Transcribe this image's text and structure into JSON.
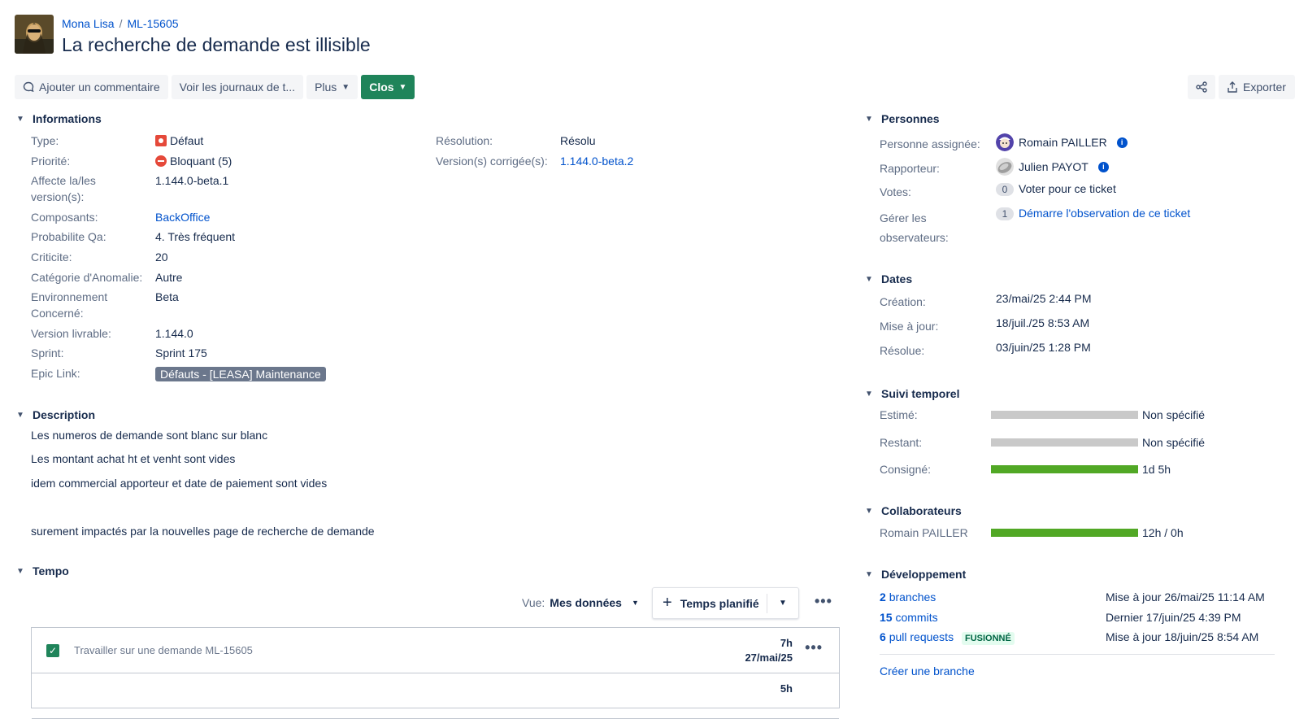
{
  "breadcrumb": {
    "project": "Mona Lisa",
    "issue_key": "ML-15605"
  },
  "title": "La recherche de demande est illisible",
  "toolbar": {
    "comment": "Ajouter un commentaire",
    "logs": "Voir les journaux de t...",
    "more": "Plus",
    "status": "Clos",
    "export": "Exporter"
  },
  "details": {
    "heading": "Informations",
    "type_label": "Type:",
    "type_value": "Défaut",
    "priority_label": "Priorité:",
    "priority_value": "Bloquant (5)",
    "affects_label_1": "Affecte la/les",
    "affects_label_2": "version(s):",
    "affects_value": "1.144.0-beta.1",
    "components_label": "Composants:",
    "components_value": "BackOffice",
    "proba_label": "Probabilite Qa:",
    "proba_value": "4. Très fréquent",
    "crit_label": "Criticite:",
    "crit_value": "20",
    "cat_label": "Catégorie d'Anomalie:",
    "cat_value": "Autre",
    "env_label_1": "Environnement",
    "env_label_2": "Concerné:",
    "env_value": "Beta",
    "deliv_label": "Version livrable:",
    "deliv_value": "1.144.0",
    "sprint_label": "Sprint:",
    "sprint_value": "Sprint 175",
    "epic_label": "Epic Link:",
    "epic_value": "Défauts - [LEASA] Maintenance",
    "resolution_label": "Résolution:",
    "resolution_value": "Résolu",
    "fixver_label": "Version(s) corrigée(s):",
    "fixver_value": "1.144.0-beta.2"
  },
  "description": {
    "heading": "Description",
    "lines": [
      "Les numeros de demande sont blanc sur blanc",
      "Les montant achat ht et venht sont vides",
      "idem commercial apporteur et date de paiement sont vides",
      "surement impactés par la nouvelles page de recherche de demande"
    ]
  },
  "tempo": {
    "heading": "Tempo",
    "view_label": "Vue:",
    "view_value": "Mes données",
    "plan_button": "Temps planifié",
    "worklog": {
      "title": "Travailler sur une demande ML-15605",
      "hours": "7h",
      "date": "27/mai/25",
      "next_hours": "5h"
    }
  },
  "people": {
    "heading": "Personnes",
    "assignee_label": "Personne assignée:",
    "assignee": "Romain PAILLER",
    "reporter_label": "Rapporteur:",
    "reporter": "Julien PAYOT",
    "votes_label": "Votes:",
    "votes_count": "0",
    "votes_action": "Voter pour ce ticket",
    "watchers_label_1": "Gérer les",
    "watchers_label_2": "observateurs:",
    "watchers_count": "1",
    "watchers_action": "Démarre l'observation de ce ticket"
  },
  "dates": {
    "heading": "Dates",
    "created_label": "Création:",
    "created": "23/mai/25 2:44 PM",
    "updated_label": "Mise à jour:",
    "updated": "18/juil./25 8:53 AM",
    "resolved_label": "Résolue:",
    "resolved": "03/juin/25 1:28 PM"
  },
  "time_tracking": {
    "heading": "Suivi temporel",
    "estimated_label": "Estimé:",
    "estimated": "Non spécifié",
    "remaining_label": "Restant:",
    "remaining": "Non spécifié",
    "logged_label": "Consigné:",
    "logged": "1d 5h"
  },
  "collaborators": {
    "heading": "Collaborateurs",
    "name": "Romain PAILLER",
    "value": "12h / 0h"
  },
  "development": {
    "heading": "Développement",
    "branches_count": "2",
    "branches_label": "branches",
    "branches_info": "Mise à jour 26/mai/25 11:14 AM",
    "commits_count": "15",
    "commits_label": "commits",
    "commits_info": "Dernier 17/juin/25 4:39 PM",
    "prs_count": "6",
    "prs_label": "pull requests",
    "prs_status": "FUSIONNÉ",
    "prs_info": "Mise à jour 18/juin/25 8:54 AM",
    "create_branch": "Créer une branche"
  },
  "colors": {
    "link": "#0052cc",
    "primary": "#1f845a",
    "bug": "#e5493a",
    "bar_grey": "#c9c9c9",
    "bar_green": "#51a825"
  }
}
